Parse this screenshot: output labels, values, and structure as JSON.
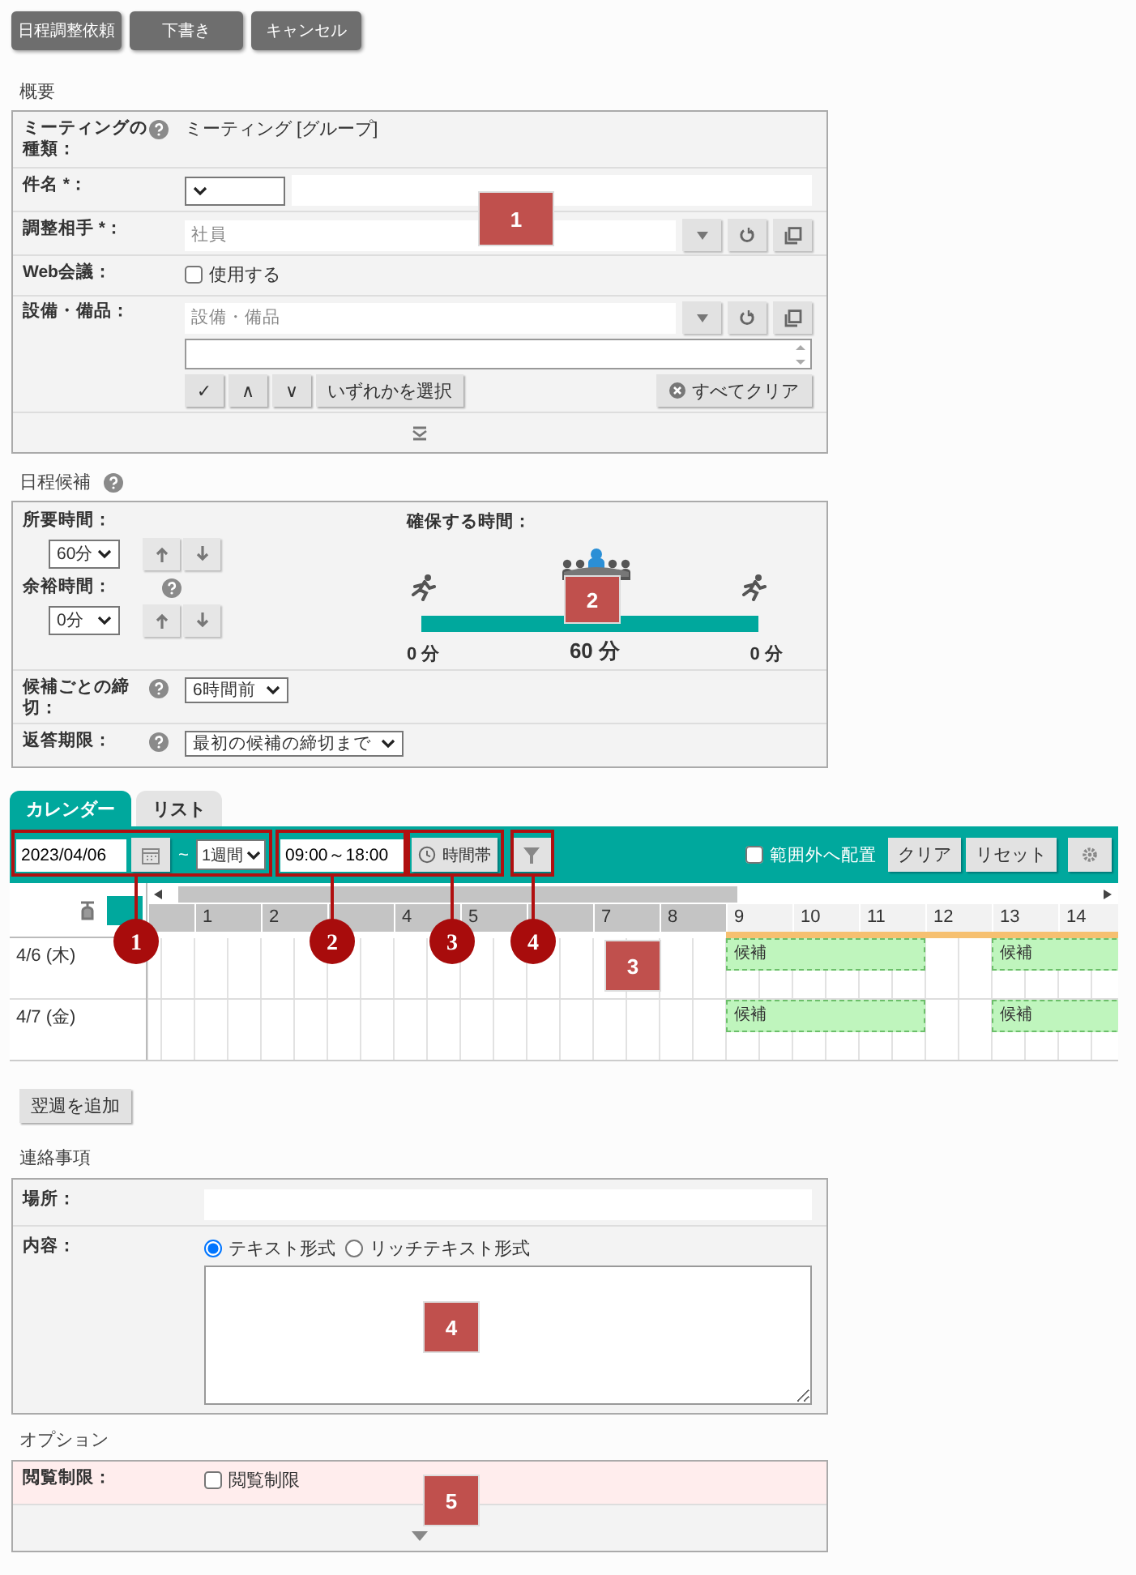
{
  "toolbar": {
    "buttons": [
      "日程調整依頼",
      "下書き",
      "キャンセル"
    ]
  },
  "overview": {
    "heading": "概要",
    "rows": [
      {
        "kind": "text",
        "label": "ミーティングの種類：",
        "help": true,
        "value": "ミーティング [グループ]"
      },
      {
        "kind": "subject",
        "label": "件名 *："
      },
      {
        "kind": "picker",
        "label": "調整相手 *：",
        "placeholder": "社員"
      },
      {
        "kind": "checkbox",
        "label": "Web会議：",
        "option": "使用する",
        "checked": false
      },
      {
        "kind": "facility",
        "label": "設備・備品：",
        "placeholder": "設備・備品",
        "buttons": [
          "✓",
          "∧",
          "∨",
          "いずれかを選択"
        ],
        "clear_button": "すべてクリア"
      }
    ]
  },
  "candidates": {
    "heading": "日程候補",
    "help": true,
    "duration": {
      "label": "所要時間：",
      "value": "60分"
    },
    "margin": {
      "label": "余裕時間：",
      "value": "0分",
      "help": true
    },
    "reserved": {
      "label": "確保する時間：",
      "before": "0 分",
      "main": "60 分",
      "after": "0 分"
    },
    "rows": [
      {
        "label": "候補ごとの締切：",
        "value": "6時間前"
      },
      {
        "label": "返答期限：",
        "value": "最初の候補の締切まで"
      }
    ]
  },
  "calendar": {
    "tabs": [
      {
        "label": "カレンダー",
        "selected": true
      },
      {
        "label": "リスト",
        "selected": false
      }
    ],
    "start_date": "2023/04/06",
    "separator": "~",
    "period": "1週間",
    "time_range": "09:00～18:00",
    "time_button": "時間帯",
    "out_of_range": {
      "label": "範囲外へ配置",
      "checked": false
    },
    "buttons": [
      "クリア",
      "リセット"
    ],
    "hours": [
      {
        "label": "1",
        "working": false
      },
      {
        "label": "2",
        "working": false
      },
      {
        "working": false
      },
      {
        "label": "4",
        "working": false
      },
      {
        "label": "5",
        "working": false
      },
      {
        "working": false
      },
      {
        "label": "7",
        "working": false
      },
      {
        "label": "8",
        "working": false
      },
      {
        "label": "9",
        "working": true
      },
      {
        "label": "10",
        "working": true
      },
      {
        "label": "11",
        "working": true
      },
      {
        "label": "12",
        "working": true
      },
      {
        "label": "13",
        "working": true
      },
      {
        "label": "14",
        "working": true
      }
    ],
    "days": [
      {
        "label": "4/6 (木)",
        "candidates": [
          {
            "label": "候補"
          },
          {
            "label": "候補"
          }
        ]
      },
      {
        "label": "4/7 (金)",
        "candidates": [
          {
            "label": "候補"
          },
          {
            "label": "候補"
          }
        ]
      }
    ]
  },
  "add_week_button": "翌週を追加",
  "contact": {
    "heading": "連絡事項",
    "location_label": "場所：",
    "content_label": "内容：",
    "formats": [
      {
        "label": "テキスト形式",
        "selected": true
      },
      {
        "label": "リッチテキスト形式",
        "selected": false
      }
    ]
  },
  "options": {
    "heading": "オプション",
    "rows": [
      {
        "label": "閲覧制限：",
        "option": "閲覧制限",
        "checked": false
      }
    ]
  },
  "annotations": {
    "numbered_boxes": [
      "1",
      "2",
      "3",
      "4",
      "5"
    ],
    "callouts": [
      "1",
      "2",
      "3",
      "4"
    ]
  }
}
